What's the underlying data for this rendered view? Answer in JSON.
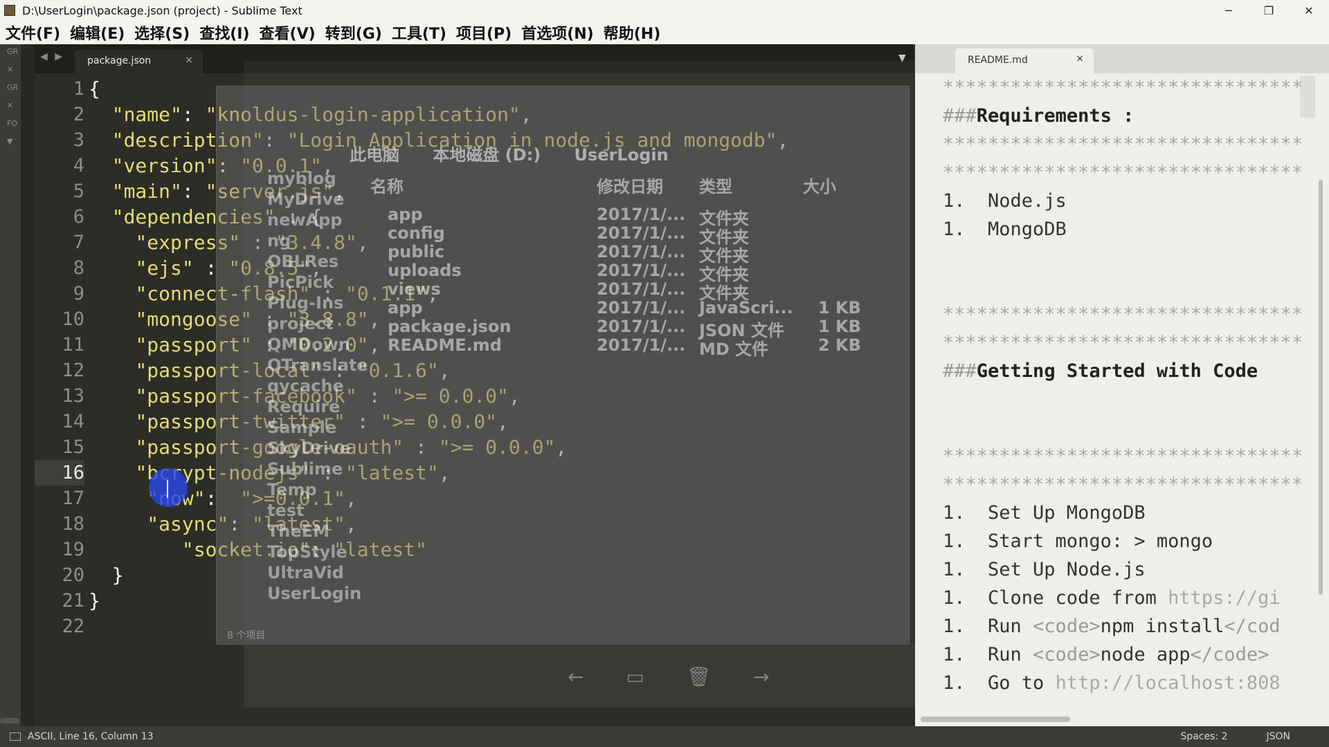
{
  "window": {
    "title": "D:\\UserLogin\\package.json (project) - Sublime Text",
    "minimize": "─",
    "restore": "❐",
    "close": "✕"
  },
  "menu": [
    "文件(F)",
    "编辑(E)",
    "选择(S)",
    "查找(I)",
    "查看(V)",
    "转到(G)",
    "工具(T)",
    "项目(P)",
    "首选项(N)",
    "帮助(H)"
  ],
  "sidebar": {
    "labels": [
      "GR",
      "✕",
      "GR",
      "✕",
      "FO",
      "▼"
    ]
  },
  "editor": {
    "tab_label": "package.json",
    "tab_close": "×",
    "nav_back": "◀",
    "nav_forward": "▶",
    "dropdown": "▼",
    "active_line": 16,
    "line_numbers": [
      "1",
      "2",
      "3",
      "4",
      "5",
      "6",
      "7",
      "8",
      "9",
      "10",
      "11",
      "12",
      "13",
      "14",
      "15",
      "16",
      "17",
      "18",
      "19",
      "20",
      "21",
      "22"
    ],
    "lines": [
      "{",
      "  \"name\": \"knoldus-login-application\",",
      "  \"description\": \"Login Application in node.js and mongodb\",",
      "  \"version\": \"0.0.1\",",
      "  \"main\": \"server.js\",",
      "  \"dependencies\" : {",
      "    \"express\" : \"3.4.8\",",
      "    \"ejs\" : \"0.8.5\",",
      "    \"connect-flash\" : \"0.1.1\",",
      "    \"mongoose\" : \"3.8.8\",",
      "    \"passport\" : \"0.2.0\",",
      "    \"passport-local\" : \"0.1.6\",",
      "    \"passport-facebook\" : \">= 0.0.0\",",
      "    \"passport-twitter\" : \">= 0.0.0\",",
      "    \"passport-google-oauth\" : \">= 0.0.0\",",
      "    \"bcrypt-nodejs\" : \"latest\",",
      "     \"now\":  \">=0.0.1\",",
      "     \"async\": \"latest\",",
      "        \"socket.io\": \"latest\"",
      "  }",
      "}",
      ""
    ]
  },
  "overlay": {
    "crumbs": [
      "此电脑",
      "本地磁盘 (D:)",
      "UserLogin"
    ],
    "columns": [
      "名称",
      "修改日期",
      "类型",
      "大小"
    ],
    "rows": [
      {
        "name": "app",
        "date": "2017/1/...",
        "type": "文件夹",
        "size": ""
      },
      {
        "name": "config",
        "date": "2017/1/...",
        "type": "文件夹",
        "size": ""
      },
      {
        "name": "public",
        "date": "2017/1/...",
        "type": "文件夹",
        "size": ""
      },
      {
        "name": "uploads",
        "date": "2017/1/...",
        "type": "文件夹",
        "size": ""
      },
      {
        "name": "views",
        "date": "2017/1/...",
        "type": "文件夹",
        "size": ""
      },
      {
        "name": "app",
        "date": "2017/1/...",
        "type": "JavaScri...",
        "size": "1 KB"
      },
      {
        "name": "package.json",
        "date": "2017/1/...",
        "type": "JSON 文件",
        "size": "1 KB"
      },
      {
        "name": "README.md",
        "date": "2017/1/...",
        "type": "MD 文件",
        "size": "2 KB"
      }
    ],
    "left_items": [
      "myblog",
      "MyDrive",
      "newApp",
      "ng",
      "OBLRes",
      "PicPick",
      "Plug-Ins",
      "project",
      "QMDown",
      "QTranslate",
      "qycache",
      "Require",
      "Sample",
      "SkyDrive",
      "Sublime",
      "Temp",
      "test",
      "TheEM",
      "TopStyle",
      "UltraVid",
      "UserLogin"
    ],
    "item_count": "8 个项目",
    "toolbar": [
      "←",
      "▭",
      "🗑",
      "→"
    ]
  },
  "readme": {
    "tab_label": "README.md",
    "tab_close": "×",
    "lines": [
      {
        "kind": "stars",
        "text": "************************************"
      },
      {
        "kind": "heading",
        "hash": "###",
        "text": "Requirements :"
      },
      {
        "kind": "stars",
        "text": "************************************"
      },
      {
        "kind": "stars",
        "text": "************************************"
      },
      {
        "kind": "list",
        "text": "1.  Node.js"
      },
      {
        "kind": "list",
        "text": "1.  MongoDB"
      },
      {
        "kind": "blank",
        "text": ""
      },
      {
        "kind": "blank",
        "text": ""
      },
      {
        "kind": "stars",
        "text": "************************************"
      },
      {
        "kind": "stars",
        "text": "************************************"
      },
      {
        "kind": "heading",
        "hash": "###",
        "text": "Getting Started with Code"
      },
      {
        "kind": "blank",
        "text": ""
      },
      {
        "kind": "blank",
        "text": ""
      },
      {
        "kind": "stars",
        "text": "************************************"
      },
      {
        "kind": "stars",
        "text": "************************************"
      },
      {
        "kind": "list",
        "text": "1.  Set Up MongoDB"
      },
      {
        "kind": "list",
        "text": "1.  Start mongo: > mongo"
      },
      {
        "kind": "list",
        "text": "1.  Set Up Node.js"
      },
      {
        "kind": "list",
        "text": "1.  Clone code from ",
        "url": "https://gi"
      },
      {
        "kind": "code",
        "text": "1.  Run ",
        "open": "<code>",
        "code": "npm install",
        "close": "</cod"
      },
      {
        "kind": "code",
        "text": "1.  Run ",
        "open": "<code>",
        "code": "node app",
        "close": "</code>"
      },
      {
        "kind": "list",
        "text": "1.  Go to ",
        "url": "http://localhost:808"
      }
    ]
  },
  "status": {
    "left": "ASCII, Line 16, Column 13",
    "spaces": "Spaces: 2",
    "syntax": "JSON"
  },
  "colors": {
    "editor_bg": "#2b2d26",
    "string": "#e6db74",
    "readme_bg": "#efefe9",
    "cursor_highlight": "#2846e6"
  }
}
